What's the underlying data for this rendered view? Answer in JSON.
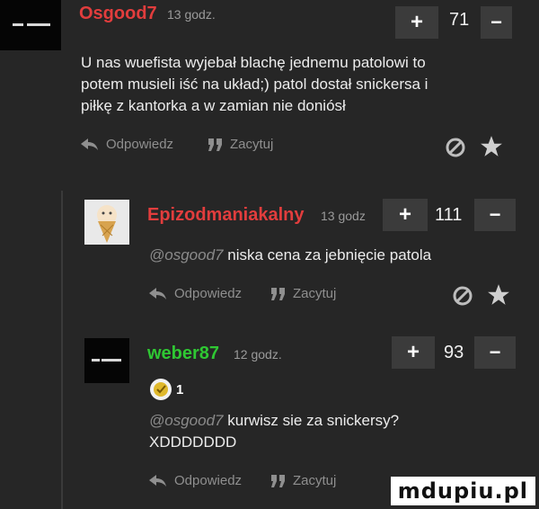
{
  "colors": {
    "username_red": "#e23d3d",
    "background": "#262626",
    "vote_button": "#3b3b3b"
  },
  "comments": [
    {
      "username": "Osgood7",
      "time": "13 godz.",
      "votes": "71",
      "text_lines": [
        "U nas wuefista wyjebał blachę jednemu patolowi to",
        "potem musieli iść na układ;) patol dostał snickersa i",
        "piłkę z kantorka a w zamian nie doniósł"
      ],
      "reply_label": "Odpowiedz",
      "quote_label": "Zacytuj",
      "plus": "+",
      "minus": "−"
    },
    {
      "username": "Epizodmaniakalny",
      "time": "13 godz",
      "votes": "111",
      "mention": "@osgood7",
      "text": "niska cena za jebnięcie patola",
      "reply_label": "Odpowiedz",
      "quote_label": "Zacytuj",
      "plus": "+",
      "minus": "−"
    },
    {
      "username": "weber87",
      "time": "12 godz.",
      "votes": "93",
      "badge_count": "1",
      "mention": "@osgood7",
      "text": "kurwisz sie za snickersy?",
      "text2": "XDDDDDDD",
      "reply_label": "Odpowiedz",
      "quote_label": "Zacytuj",
      "plus": "+",
      "minus": "−"
    }
  ],
  "icons": [
    "reply-icon",
    "quote-icon",
    "report-icon",
    "star-icon",
    "medal-icon"
  ],
  "watermark": "mdupiu.pl"
}
